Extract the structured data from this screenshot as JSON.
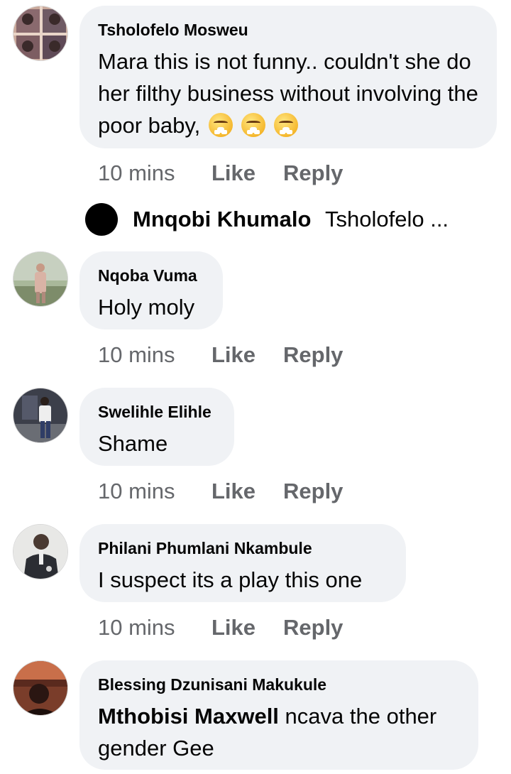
{
  "comments": [
    {
      "name": "Tsholofelo Mosweu",
      "text": "Mara this is not funny.. couldn't she do her filthy business without involving the poor baby,",
      "emojis": [
        "weary-face",
        "weary-face",
        "weary-face"
      ],
      "time": "10 mins",
      "like": "Like",
      "reply": "Reply"
    },
    {
      "name": "Nqoba Vuma",
      "text": "Holy moly",
      "time": "10 mins",
      "like": "Like",
      "reply": "Reply"
    },
    {
      "name": "Swelihle Elihle",
      "text": "Shame",
      "time": "10 mins",
      "like": "Like",
      "reply": "Reply"
    },
    {
      "name": "Philani Phumlani Nkambule",
      "text": "I suspect its a play this one",
      "time": "10 mins",
      "like": "Like",
      "reply": "Reply"
    },
    {
      "name": "Blessing Dzunisani Makukule",
      "mention": "Mthobisi Maxwell",
      "text": "ncava the other gender Gee"
    }
  ],
  "reply_preview": {
    "name": "Mnqobi Khumalo",
    "preview": "Tsholofelo ..."
  },
  "colors": {
    "bubble": "#f0f2f5",
    "meta_text": "#65676b",
    "text": "#050505"
  }
}
